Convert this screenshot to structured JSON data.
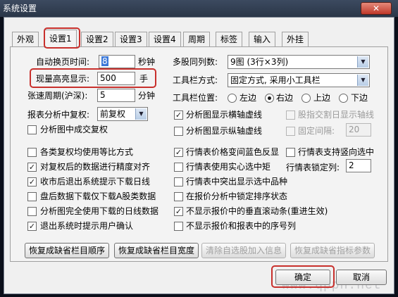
{
  "window": {
    "title": "系统设置",
    "close_label": "✕"
  },
  "tabs": [
    {
      "label": "外观"
    },
    {
      "label": "设置1"
    },
    {
      "label": "设置2"
    },
    {
      "label": "设置3"
    },
    {
      "label": "设置4"
    },
    {
      "label": "周期"
    },
    {
      "label": "标签"
    },
    {
      "label": "输入"
    },
    {
      "label": "外挂"
    }
  ],
  "left": {
    "auto_page_label": "自动换页时间:",
    "auto_page_value": "8",
    "auto_page_unit": "秒钟",
    "volume_label": "现量高亮显示:",
    "volume_value": "500",
    "volume_unit": "手",
    "speed_label": "张速周期(沪深):",
    "speed_value": "5",
    "speed_unit": "分钟",
    "restore_label": "报表分析中复权:",
    "restore_value": "前复权",
    "show_restored_vol": "分析图中成交复权"
  },
  "right": {
    "multi_stock_label": "多股同列数:",
    "multi_stock_value": "9图 (3行×3列)",
    "toolbar_mode_label": "工具栏方式:",
    "toolbar_mode_value": "固定方式, 采用小工具栏",
    "toolbar_pos_label": "工具栏位置:",
    "pos_left": "左边",
    "pos_right": "右边",
    "pos_top": "上边",
    "pos_bottom": "下边",
    "show_h_axis": "分析图显示横轴虚线",
    "show_v_axis": "分析图显示纵轴虚线",
    "stock_daily_axis": "股指交割日显示轴线",
    "fixed_interval": "固定间隔:",
    "fixed_interval_value": "20"
  },
  "options_left": [
    {
      "label": "各类复权均使用等比方式",
      "checked": false
    },
    {
      "label": "对复权后的数据进行精度对齐",
      "checked": true
    },
    {
      "label": "收市后退出系统提示下载日线",
      "checked": true
    },
    {
      "label": "盘后数据下载仅下载A股类数据",
      "checked": false
    },
    {
      "label": "分析图完全使用下载的日线数据",
      "checked": false
    },
    {
      "label": "退出系统时提示用户确认",
      "checked": true
    }
  ],
  "options_right": [
    {
      "label": "行情表价格变间蓝色反显",
      "checked": true
    },
    {
      "label": "行情表使用实心选中矩",
      "checked": false
    },
    {
      "label": "行情表中突出显示选中品种",
      "checked": false
    },
    {
      "label": "在报价分析中锁定排序状态",
      "checked": false
    },
    {
      "label": "不显示报价中的垂直滚动条(重进生效)",
      "checked": true
    },
    {
      "label": "不显示报价和报表中的序号列",
      "checked": false
    }
  ],
  "extra": {
    "vertical_select_label": "行情表支持竖向选中",
    "lock_columns_label": "行情表锁定列:",
    "lock_columns_value": "2"
  },
  "buttons": {
    "restore_col_order": "恢复成缺省栏目顺序",
    "restore_col_width": "恢复成缺省栏目宽度",
    "clear_selfselect": "清除自选股加入信息",
    "restore_indicator": "恢复成缺省指标参数",
    "ok": "确定",
    "cancel": "取消"
  },
  "watermark": "www.qpph.net",
  "colors": {
    "highlight": "#c8302c",
    "titlebar": "#2f3c50"
  }
}
